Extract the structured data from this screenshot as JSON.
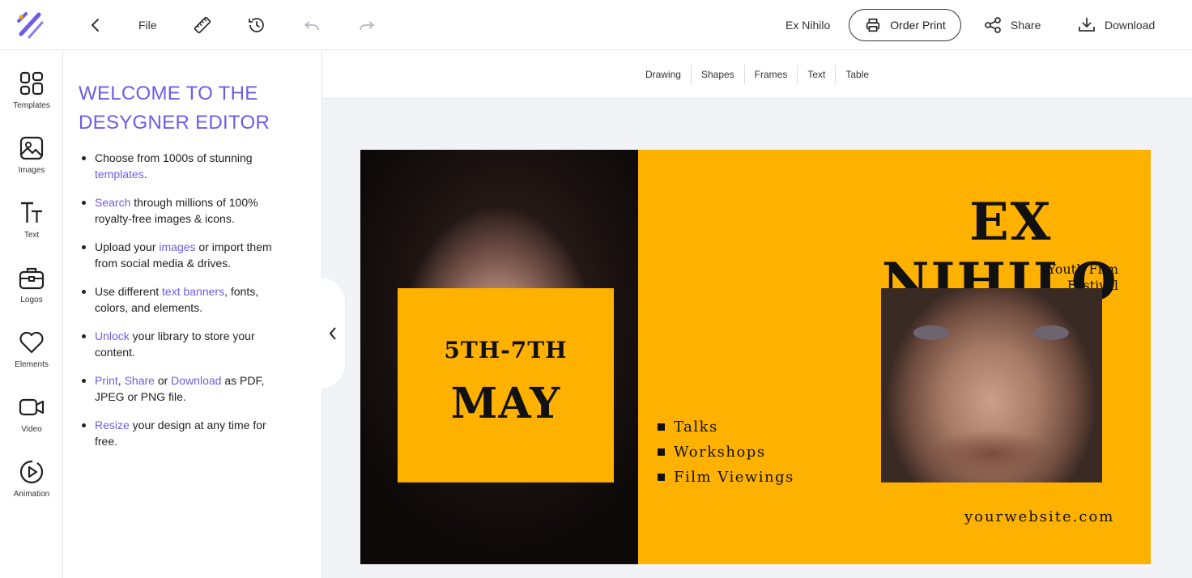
{
  "header": {
    "back_icon": "chevron-left-icon",
    "file_label": "File",
    "ruler_icon": "ruler-icon",
    "history_icon": "history-icon",
    "undo_icon": "undo-icon",
    "redo_icon": "redo-icon",
    "document_name": "Ex Nihilo",
    "order_print_label": "Order Print",
    "share_label": "Share",
    "download_label": "Download",
    "accent_color": "#6d5ce8"
  },
  "sidebar": {
    "items": [
      {
        "label": "Templates",
        "icon": "templates-icon"
      },
      {
        "label": "Images",
        "icon": "image-icon"
      },
      {
        "label": "Text",
        "icon": "text-icon"
      },
      {
        "label": "Logos",
        "icon": "briefcase-icon"
      },
      {
        "label": "Elements",
        "icon": "heart-icon"
      },
      {
        "label": "Video",
        "icon": "video-icon"
      },
      {
        "label": "Animation",
        "icon": "play-circle-icon"
      }
    ]
  },
  "panel": {
    "title": "WELCOME TO THE DESYGNER EDITOR",
    "tips": [
      {
        "a": "Choose from 1000s of stunning ",
        "link": "templates",
        "b": "."
      },
      {
        "link": "Search",
        "b": " through millions of 100% royalty-free images & icons."
      },
      {
        "a": "Upload your ",
        "link": "images",
        "b": " or import them from social media & drives."
      },
      {
        "a": "Use different ",
        "link": "text banners",
        "b": ", fonts, colors, and elements."
      },
      {
        "link": "Unlock",
        "b": " your library to store your content."
      },
      {
        "link": "Print",
        "sep1": ", ",
        "link2": "Share",
        "sep2": " or ",
        "link3": "Download",
        "b": " as PDF, JPEG or PNG file."
      },
      {
        "link": "Resize",
        "b": " your design at any time for free."
      }
    ]
  },
  "subtoolbar": {
    "items": [
      "Drawing",
      "Shapes",
      "Frames",
      "Text",
      "Table"
    ]
  },
  "design": {
    "background_color": "#ffb100",
    "date_line1": "5TH-7TH",
    "date_line2": "MAY",
    "title_line1": "EX",
    "title_line2": "NIHILO",
    "subtitle": "Youth Film Festival",
    "features": [
      "Talks",
      "Workshops",
      "Film Viewings"
    ],
    "website": "yourwebsite.com"
  }
}
